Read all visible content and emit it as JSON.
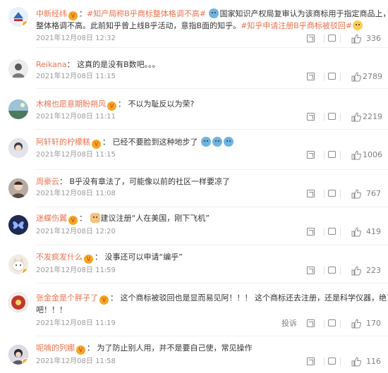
{
  "comments": [
    {
      "user": "中新经纬",
      "topic1": "#知产局称B乎商标整体格调不高#",
      "body": "国家知识产权局复审认为该商标用于指定商品上，",
      "body2": "整体格调不高。此前知乎曾上线B乎活动，意指B面的知乎。",
      "topic2": "#知乎申请注册B乎商标被驳回#",
      "time": "2021年12月08日 12:32",
      "likes": "336",
      "avatar_color": "#d0e4f5"
    },
    {
      "user": "Reikana",
      "body": "这真的是没有B数吧。。。",
      "time": "2021年12月08日 11:15",
      "likes": "2789",
      "avatar_color": "#c9c9c9"
    },
    {
      "user": "木棉也愿意期盼朔风",
      "body": "不以为耻反以为荣?",
      "time": "2021年12月08日 11:11",
      "likes": "2219",
      "avatar_color": "#7aa3b8"
    },
    {
      "user": "阿轩轩的柠檬糕",
      "body": "已经不要脸到这种地步了",
      "time": "2021年12月08日 11:15",
      "likes": "1006",
      "avatar_color": "#b8b8c8"
    },
    {
      "user": "周豪云",
      "body": "B乎没有章法了，可能像以前的社区一样要凉了",
      "time": "2021年12月08日 11:08",
      "likes": "767",
      "avatar_color": "#9a8c80"
    },
    {
      "user": "迷蝶伤翼",
      "body": "建议注册“人在美国，刚下飞机”",
      "time": "2021年12月08日 12:20",
      "likes": "419",
      "avatar_color": "#2d3a6b"
    },
    {
      "user": "不发疯发什么",
      "body": "没事还可以申请“编乎”",
      "time": "2021年12月08日 11:59",
      "likes": "223",
      "avatar_color": "#e8e0d8"
    },
    {
      "user": "张金金是个胖子了",
      "body": "这个商标被驳回也是显而易见阿！！！  这个商标还去注册，还是科学仪器，绝了",
      "body2": "吧！！！",
      "time": "2021年12月08日 11:19",
      "likes": "170",
      "report": "投诉",
      "avatar_color": "#c0392b"
    },
    {
      "user": "呢喃的列娜",
      "body": "为了防止别人用，并不是要自己使，常见操作",
      "time": "2021年12月08日 11:58",
      "likes": "116",
      "avatar_color": "#8a8a9a"
    }
  ]
}
